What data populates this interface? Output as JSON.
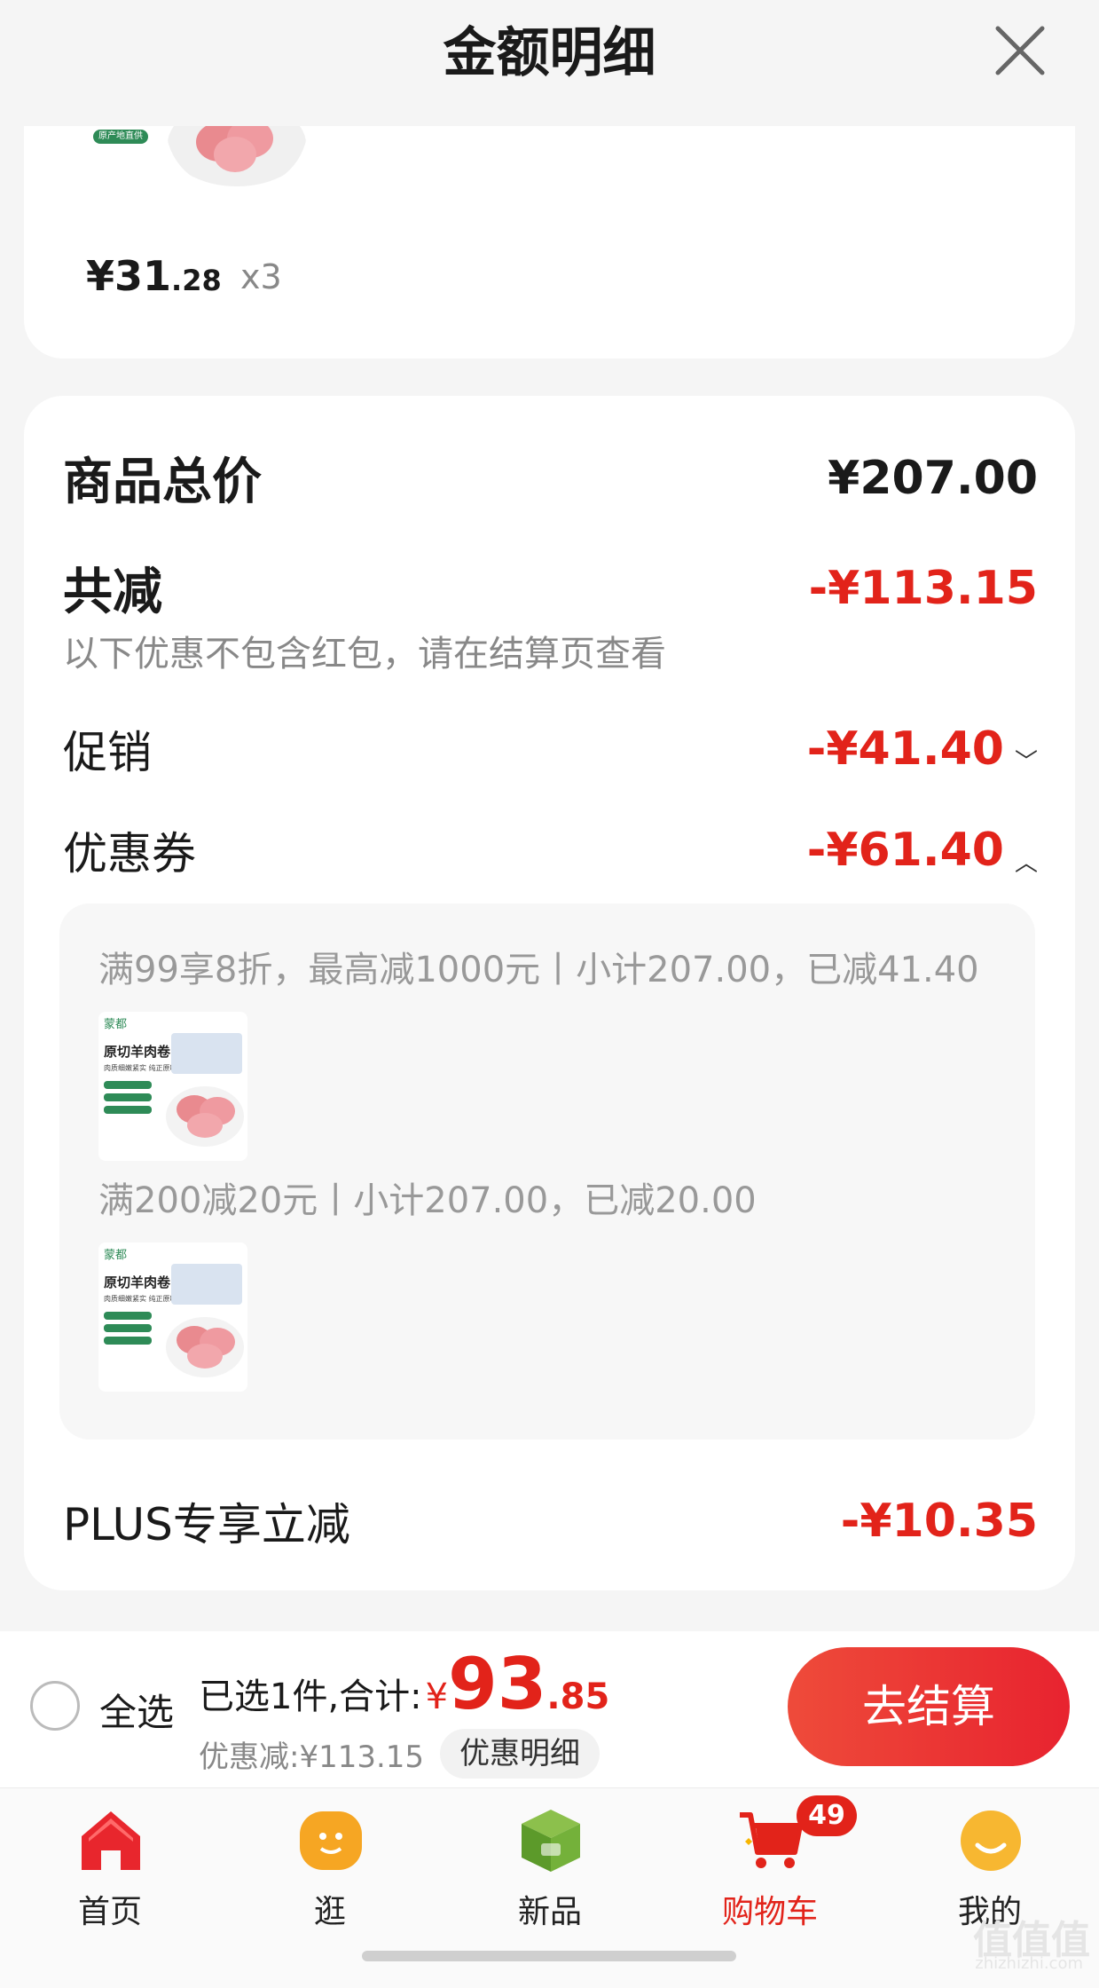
{
  "header": {
    "title": "金额明细"
  },
  "prev_item": {
    "tag": "原产地直供",
    "price_int": "¥31",
    "price_dec": ".28",
    "qty": "x3"
  },
  "summary": {
    "total_label": "商品总价",
    "total_value": "¥207.00",
    "reduce_label": "共减",
    "reduce_value": "-¥113.15",
    "reduce_note": "以下优惠不包含红包，请在结算页查看",
    "promo_label": "促销",
    "promo_value": "-¥41.40",
    "coupon_label": "优惠券",
    "coupon_value": "-¥61.40",
    "plus_label": "PLUS专享立减",
    "plus_value": "-¥10.35"
  },
  "coupons": [
    {
      "text": "满99享8折，最高减1000元丨小计207.00，已减41.40"
    },
    {
      "text": "满200减20元丨小计207.00，已减20.00"
    }
  ],
  "product_thumb": {
    "brand": "蒙都",
    "name": "原切羊肉卷",
    "sub": "肉质细嫩紧实 纯正原味"
  },
  "bottom_bar": {
    "select_all": "全选",
    "selected_prefix": "已选1件,合计:",
    "currency": "¥",
    "amount_int": "93",
    "amount_dec": ".85",
    "discount_text": "优惠减:¥113.15",
    "detail_button": "优惠明细",
    "checkout_button": "去结算"
  },
  "tabs": [
    {
      "label": "首页",
      "icon": "home-icon"
    },
    {
      "label": "逛",
      "icon": "stroll-icon"
    },
    {
      "label": "新品",
      "icon": "new-products-icon"
    },
    {
      "label": "购物车",
      "icon": "cart-icon",
      "badge": "49"
    },
    {
      "label": "我的",
      "icon": "profile-icon"
    }
  ],
  "watermark": {
    "glyphs": "值值值",
    "url": "zhizhizhi.com"
  },
  "colors": {
    "accent": "#e2231a",
    "background": "#f5f5f5"
  }
}
